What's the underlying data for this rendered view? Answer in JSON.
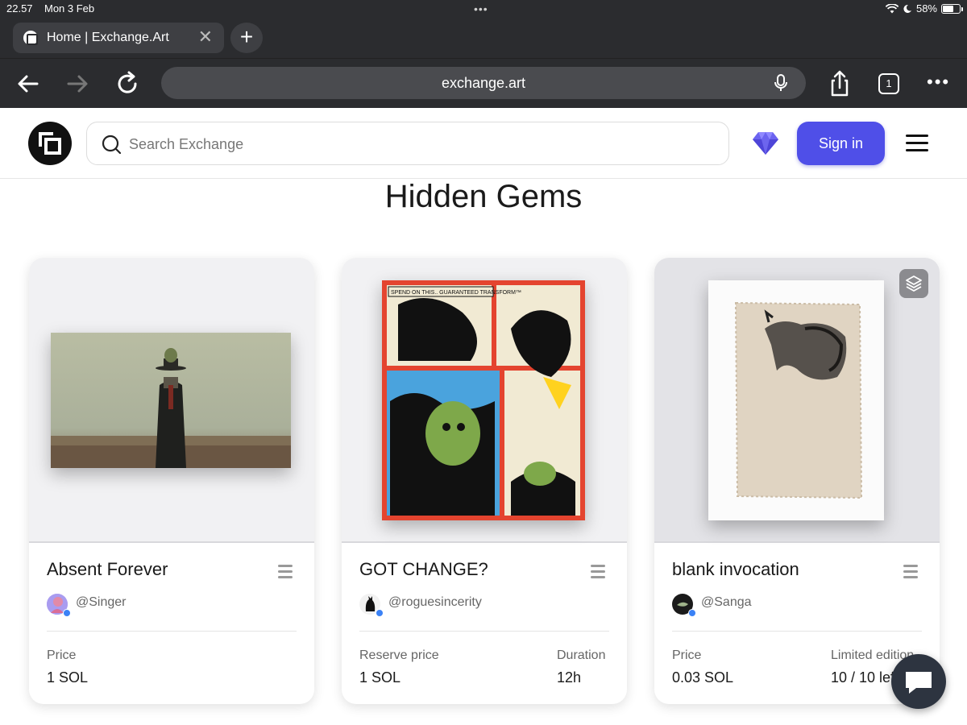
{
  "status_bar": {
    "time": "22.57",
    "date": "Mon 3 Feb",
    "battery": "58%",
    "battery_level": 0.58
  },
  "browser": {
    "tab_title": "Home | Exchange.Art",
    "url": "exchange.art",
    "tab_count": "1"
  },
  "header": {
    "search_placeholder": "Search Exchange",
    "signin_label": "Sign in"
  },
  "section": {
    "title": "Hidden Gems"
  },
  "cards": [
    {
      "name": "Absent Forever",
      "handle": "@Singer",
      "labels": [
        "Price"
      ],
      "values": [
        "1 SOL"
      ]
    },
    {
      "name": "GOT CHANGE?",
      "handle": "@roguesincerity",
      "labels": [
        "Reserve price",
        "Duration"
      ],
      "values": [
        "1 SOL",
        "12h"
      ],
      "art_caption": "SPEND ON THIS.. GUARANTEED TRANSFORM™"
    },
    {
      "name": "blank invocation",
      "handle": "@Sanga",
      "labels": [
        "Price",
        "Limited edition"
      ],
      "values": [
        "0.03 SOL",
        "10 / 10 left"
      ]
    }
  ],
  "icons": [
    "back-icon",
    "forward-icon",
    "reload-icon",
    "mic-icon",
    "share-icon",
    "gem-icon",
    "search-icon",
    "hamburger-icon",
    "chat-icon",
    "stack-icon"
  ]
}
